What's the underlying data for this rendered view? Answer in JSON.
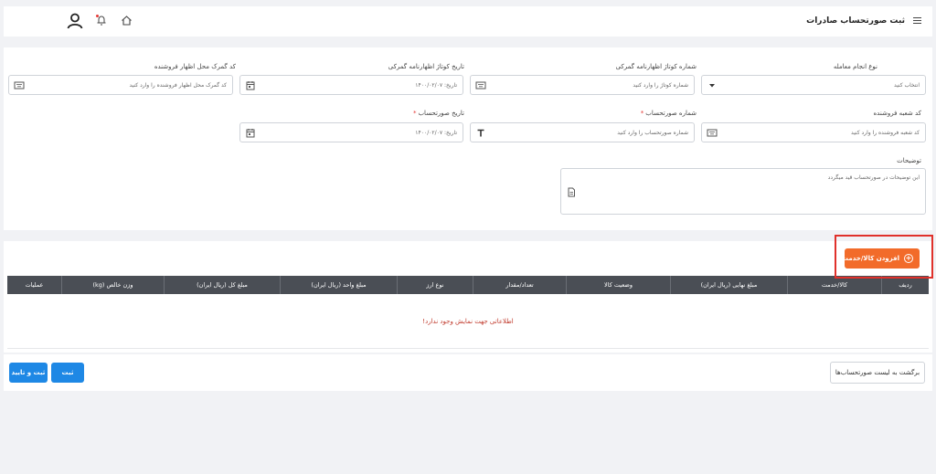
{
  "header": {
    "title": "ثبت صورتحساب صادرات"
  },
  "form": {
    "row1": [
      {
        "label": "نوع انجام معامله",
        "placeholder": "انتخاب کنید",
        "icon": "chevron-down-icon"
      },
      {
        "label": "شماره کوتاژ اظهارنامه گمرکی",
        "placeholder": "شماره کوتاژ را وارد کنید",
        "icon": "keyboard-icon"
      },
      {
        "label": "تاریخ کوتاژ اظهارنامه گمرکی",
        "placeholder": "تاریخ: ۱۴۰۰/۰۲/۰۷",
        "icon": "calendar-icon"
      },
      {
        "label": "کد گمرک محل اظهار فروشنده",
        "placeholder": "کد گمرک محل اظهار فروشنده را وارد کنید",
        "icon": "keyboard-icon"
      }
    ],
    "row2": [
      {
        "label": "کد شعبه فروشنده",
        "placeholder": "کد شعبه فروشنده را وارد کنید",
        "icon": "keyboard-icon",
        "required": false
      },
      {
        "label": "شماره صورتحساب",
        "placeholder": "شماره صورتحساب را وارد کنید",
        "icon": "text-icon",
        "required": true
      },
      {
        "label": "تاریخ صورتحساب",
        "placeholder": "تاریخ: ۱۴۰۰/۰۲/۰۷",
        "icon": "calendar-icon",
        "required": true
      }
    ],
    "required_mark": "*",
    "description": {
      "label": "توضیحات",
      "placeholder": "این توضیحات در صورتحساب قید میگردد"
    }
  },
  "items": {
    "add_button": "افزودن کالا/خدمت",
    "columns": [
      "ردیف",
      "کالا/خدمت",
      "مبلغ نهایی (ریال ایران)",
      "وضعیت کالا",
      "تعداد/مقدار",
      "نوع ارز",
      "مبلغ واحد (ریال ایران)",
      "مبلغ کل (ریال ایران)",
      "وزن خالص (kg)",
      "عملیات"
    ],
    "empty_message": "اطلاعاتی جهت نمایش وجود ندارد!"
  },
  "footer": {
    "back_button": "برگشت به لیست صورتحساب‌ها",
    "submit_button": "ثبت",
    "submit_confirm_button": "ثبت و تایید"
  },
  "colors": {
    "accent_orange": "#f26b2a",
    "primary_blue": "#1e88e5",
    "table_header": "#4a4e55",
    "highlight_red": "#e0312b"
  }
}
